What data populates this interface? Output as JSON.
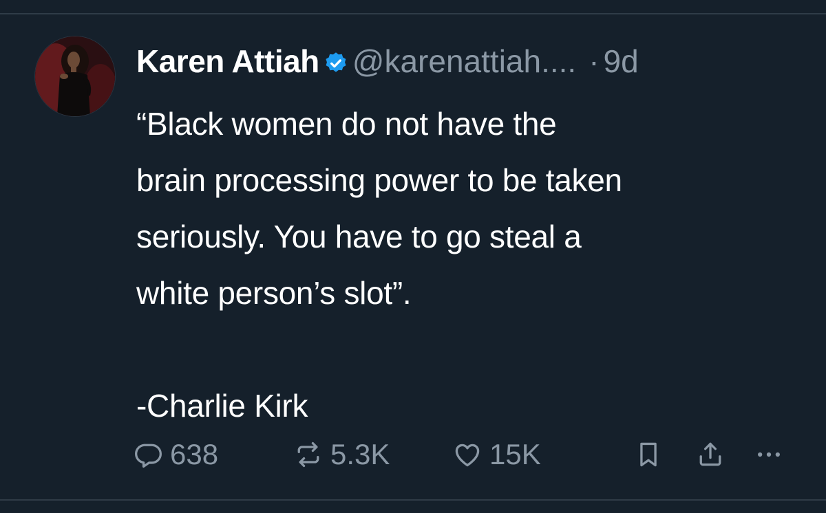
{
  "tweet": {
    "author_name": "Karen Attiah",
    "handle": "@karenattiah....",
    "separator": "·",
    "time_ago": "9d",
    "text_lines": [
      "“Black women do not have the",
      "brain processing power to be taken",
      "seriously. You have to go steal a",
      "white person’s slot”."
    ],
    "attribution": "-Charlie Kirk"
  },
  "actions": {
    "reply_count": "638",
    "retweet_count": "5.3K",
    "like_count": "15K"
  },
  "icons": {
    "verified": "verified-badge-icon",
    "reply": "reply-icon",
    "retweet": "retweet-icon",
    "like": "heart-icon",
    "bookmark": "bookmark-icon",
    "share": "share-icon",
    "more": "more-icon"
  },
  "colors": {
    "background": "#15202b",
    "text_primary": "#ffffff",
    "text_secondary": "#8b98a5",
    "verified_blue": "#1d9bf0",
    "divider": "#2f3b47"
  }
}
